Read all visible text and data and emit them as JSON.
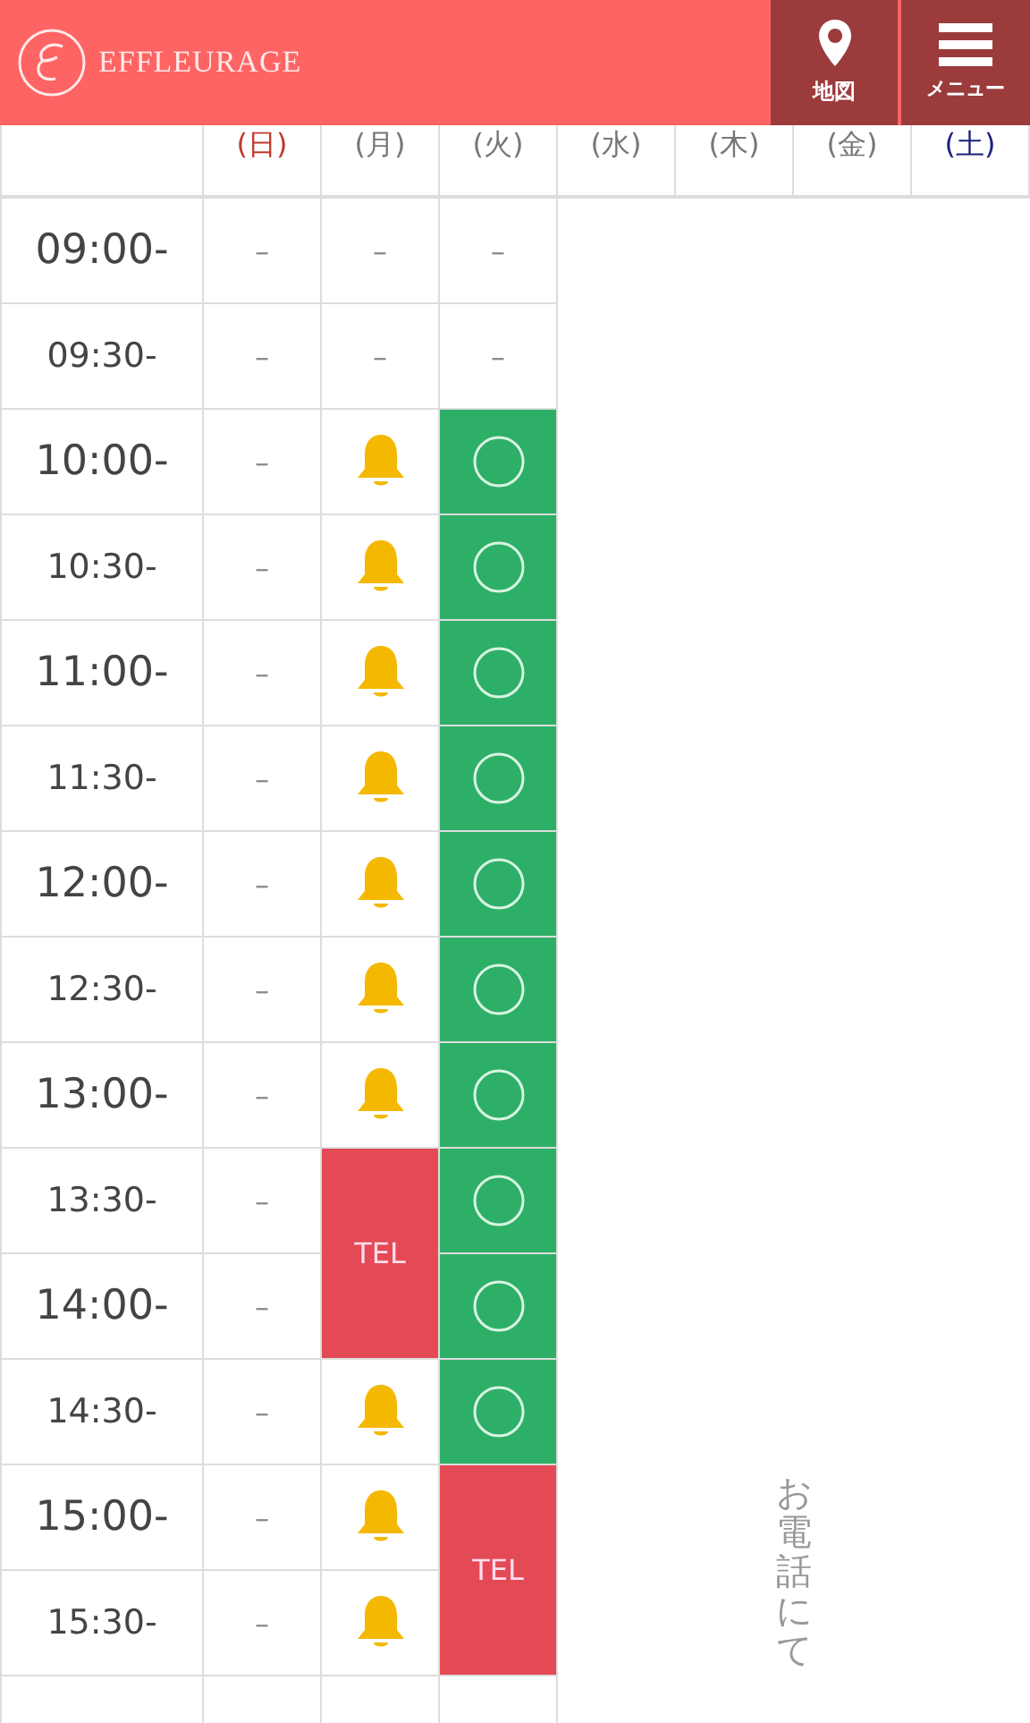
{
  "header": {
    "brand": "EFFLEURAGE",
    "buttons": [
      {
        "kind": "map",
        "label": "地図"
      },
      {
        "kind": "menu",
        "label": "メニュー"
      }
    ]
  },
  "table": {
    "days": [
      {
        "label": "(日)",
        "color": "#c0392b"
      },
      {
        "label": "(月)",
        "color": "#777777"
      },
      {
        "label": "(火)",
        "color": "#777777"
      },
      {
        "label": "(水)",
        "color": "#777777"
      },
      {
        "label": "(木)",
        "color": "#777777"
      },
      {
        "label": "(金)",
        "color": "#777777"
      },
      {
        "label": "(土)",
        "color": "#1a237e"
      }
    ],
    "rows": [
      {
        "time": "09:00-",
        "kind": "hour",
        "cells": [
          {
            "kind": "dash",
            "text": "–"
          },
          {
            "kind": "dash",
            "text": "–"
          },
          {
            "kind": "dash",
            "text": "–"
          }
        ]
      },
      {
        "time": "09:30-",
        "kind": "half",
        "cells": [
          {
            "kind": "dash",
            "text": "–"
          },
          {
            "kind": "dash",
            "text": "–"
          },
          {
            "kind": "dash",
            "text": "–"
          }
        ]
      },
      {
        "time": "10:00-",
        "kind": "hour",
        "cells": [
          {
            "kind": "dash",
            "text": "–"
          },
          {
            "kind": "bell"
          },
          {
            "kind": "open"
          }
        ]
      },
      {
        "time": "10:30-",
        "kind": "half",
        "cells": [
          {
            "kind": "dash",
            "text": "–"
          },
          {
            "kind": "bell"
          },
          {
            "kind": "open"
          }
        ]
      },
      {
        "time": "11:00-",
        "kind": "hour",
        "cells": [
          {
            "kind": "dash",
            "text": "–"
          },
          {
            "kind": "bell"
          },
          {
            "kind": "open"
          }
        ]
      },
      {
        "time": "11:30-",
        "kind": "half",
        "cells": [
          {
            "kind": "dash",
            "text": "–"
          },
          {
            "kind": "bell"
          },
          {
            "kind": "open"
          }
        ]
      },
      {
        "time": "12:00-",
        "kind": "hour",
        "cells": [
          {
            "kind": "dash",
            "text": "–"
          },
          {
            "kind": "bell"
          },
          {
            "kind": "open"
          }
        ]
      },
      {
        "time": "12:30-",
        "kind": "half",
        "cells": [
          {
            "kind": "dash",
            "text": "–"
          },
          {
            "kind": "bell"
          },
          {
            "kind": "open"
          }
        ]
      },
      {
        "time": "13:00-",
        "kind": "hour",
        "cells": [
          {
            "kind": "dash",
            "text": "–"
          },
          {
            "kind": "bell"
          },
          {
            "kind": "open"
          }
        ]
      },
      {
        "time": "13:30-",
        "kind": "half",
        "cells": [
          {
            "kind": "dash",
            "text": "–"
          },
          {
            "kind": "tel",
            "text": "TEL"
          },
          {
            "kind": "open"
          }
        ]
      },
      {
        "time": "14:00-",
        "kind": "hour",
        "cells": [
          {
            "kind": "dash",
            "text": "–"
          },
          {
            "kind": "covered"
          },
          {
            "kind": "open"
          }
        ]
      },
      {
        "time": "14:30-",
        "kind": "half",
        "cells": [
          {
            "kind": "dash",
            "text": "–"
          },
          {
            "kind": "bell"
          },
          {
            "kind": "open"
          }
        ]
      },
      {
        "time": "15:00-",
        "kind": "hour",
        "cells": [
          {
            "kind": "dash",
            "text": "–"
          },
          {
            "kind": "bell"
          },
          {
            "kind": "tel",
            "text": "TEL"
          }
        ]
      },
      {
        "time": "15:30-",
        "kind": "half",
        "cells": [
          {
            "kind": "dash",
            "text": "–"
          },
          {
            "kind": "bell"
          },
          {
            "kind": "covered"
          }
        ]
      }
    ],
    "closed_note": "お電話にて"
  }
}
